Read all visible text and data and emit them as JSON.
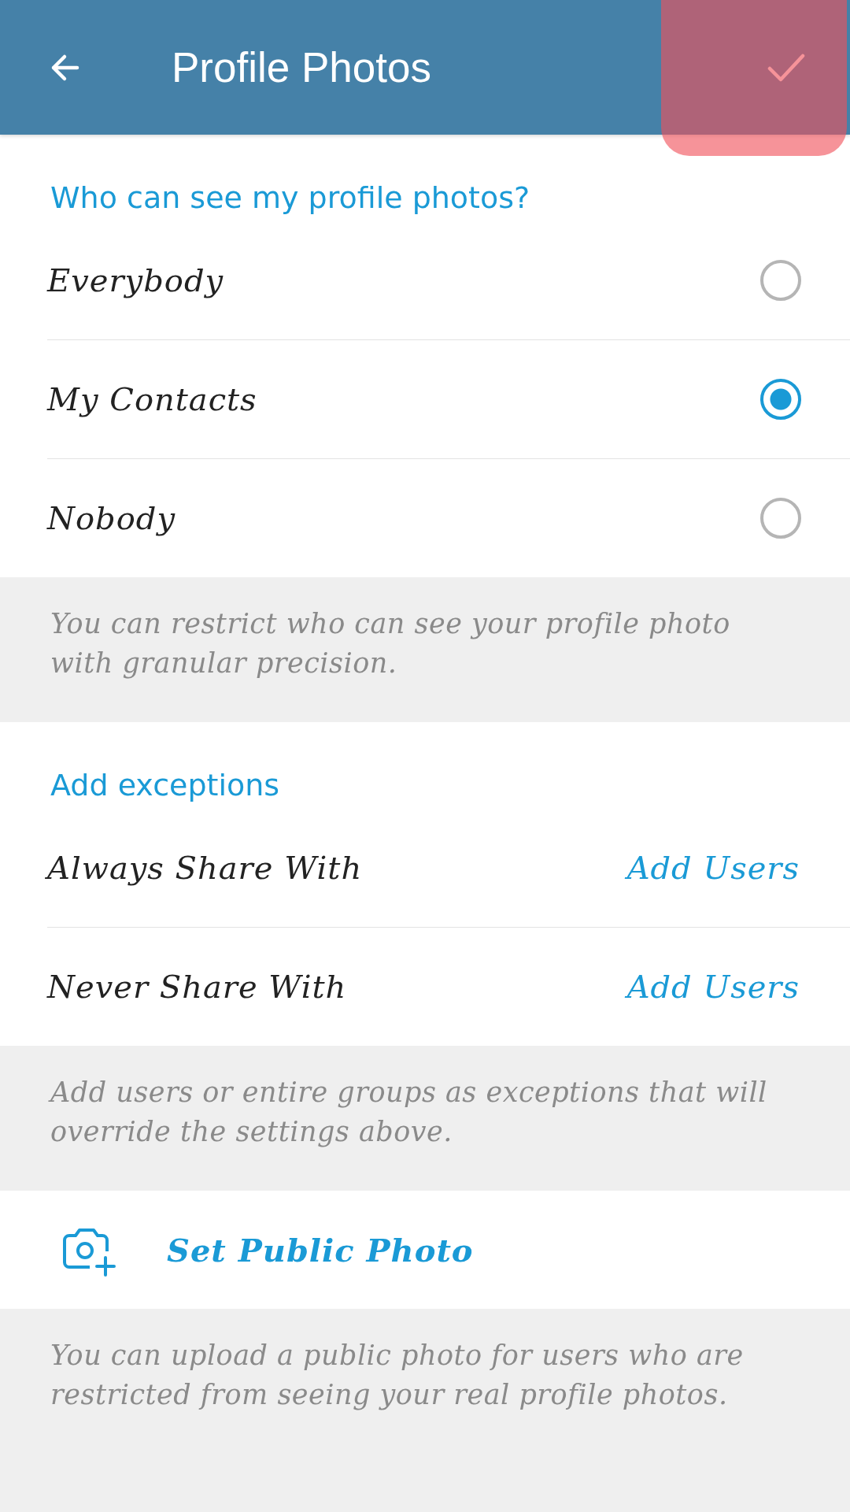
{
  "header": {
    "title": "Profile Photos",
    "confirm_highlighted": true
  },
  "visibility": {
    "heading": "Who can see my profile photos?",
    "options": [
      {
        "label": "Everybody",
        "selected": false
      },
      {
        "label": "My Contacts",
        "selected": true
      },
      {
        "label": "Nobody",
        "selected": false
      }
    ],
    "note": "You can restrict who can see your profile photo with granular precision."
  },
  "exceptions": {
    "heading": "Add exceptions",
    "rows": [
      {
        "label": "Always Share With",
        "action": "Add Users"
      },
      {
        "label": "Never Share With",
        "action": "Add Users"
      }
    ],
    "note": "Add users or entire groups as exceptions that will override the settings above."
  },
  "public_photo": {
    "label": "Set Public Photo",
    "note": "You can upload a public photo for users who are restricted from seeing your real profile photos."
  }
}
